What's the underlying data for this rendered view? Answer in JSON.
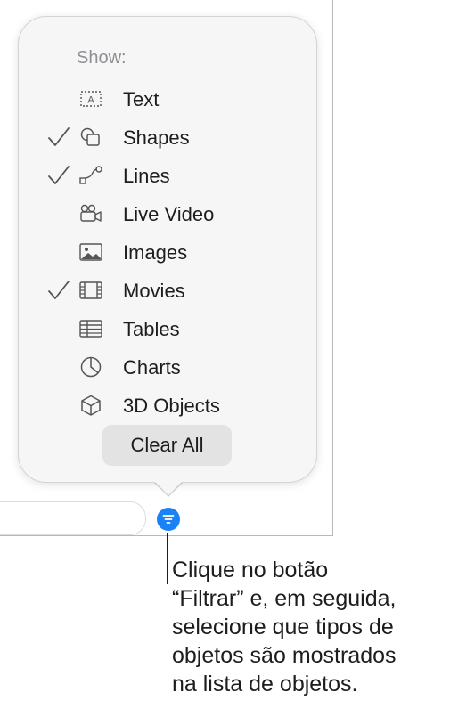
{
  "popover": {
    "header": "Show:",
    "items": [
      {
        "label": "Text",
        "icon": "text-box-icon",
        "checked": false
      },
      {
        "label": "Shapes",
        "icon": "shapes-icon",
        "checked": true
      },
      {
        "label": "Lines",
        "icon": "lines-icon",
        "checked": true
      },
      {
        "label": "Live Video",
        "icon": "live-video-icon",
        "checked": false
      },
      {
        "label": "Images",
        "icon": "image-icon",
        "checked": false
      },
      {
        "label": "Movies",
        "icon": "film-icon",
        "checked": true
      },
      {
        "label": "Tables",
        "icon": "table-icon",
        "checked": false
      },
      {
        "label": "Charts",
        "icon": "pie-chart-icon",
        "checked": false
      },
      {
        "label": "3D Objects",
        "icon": "cube-icon",
        "checked": false
      }
    ],
    "clear_button": "Clear All"
  },
  "filter_button": {
    "icon": "filter-icon",
    "color": "#1a82f6"
  },
  "callout": {
    "lines": [
      "Clique no botão",
      "“Filtrar” e, em seguida,",
      "selecione que tipos de",
      "objetos são mostrados",
      "na lista de objetos."
    ]
  }
}
